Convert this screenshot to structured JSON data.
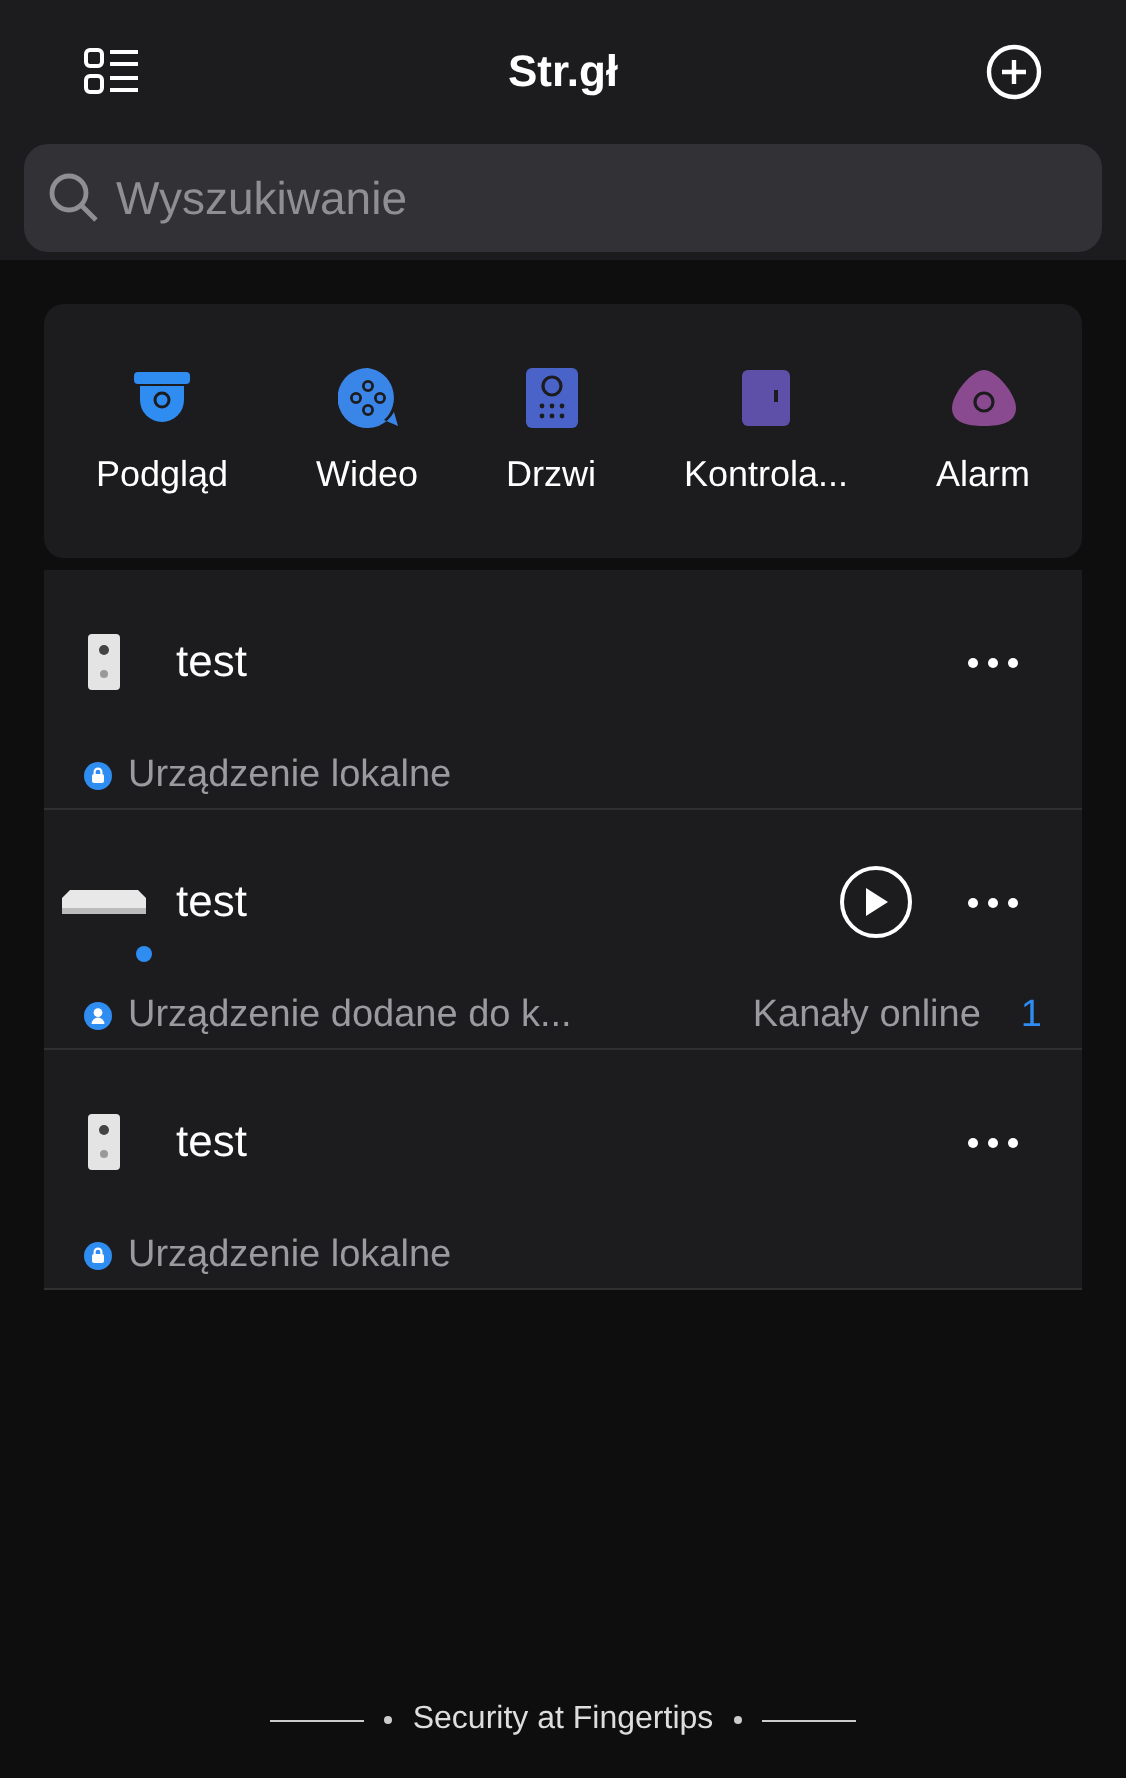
{
  "header": {
    "title": "Str.gł"
  },
  "search": {
    "placeholder": "Wyszukiwanie"
  },
  "categories": [
    {
      "label": "Podgląd",
      "kind": "camera",
      "color": "#2f8cf0"
    },
    {
      "label": "Wideo",
      "kind": "video",
      "color": "#3a86e8"
    },
    {
      "label": "Drzwi",
      "kind": "intercom",
      "color": "#4a63c9"
    },
    {
      "label": "Kontrola...",
      "kind": "access",
      "color": "#5e4fa8"
    },
    {
      "label": "Alarm",
      "kind": "alarm",
      "color": "#8a4a90"
    }
  ],
  "devices": [
    {
      "name": "test",
      "kind": "doorbell",
      "online": false,
      "source": {
        "kind": "local",
        "label": "Urządzenie lokalne"
      },
      "play": false
    },
    {
      "name": "test",
      "kind": "recorder",
      "online": true,
      "source": {
        "kind": "cloud",
        "label": "Urządzenie dodane do k..."
      },
      "play": true,
      "channels_label": "Kanały online",
      "channels_count": "1"
    },
    {
      "name": "test",
      "kind": "doorbell",
      "online": false,
      "source": {
        "kind": "local",
        "label": "Urządzenie lokalne"
      },
      "play": false
    }
  ],
  "footer": {
    "slogan": "Security at Fingertips"
  }
}
